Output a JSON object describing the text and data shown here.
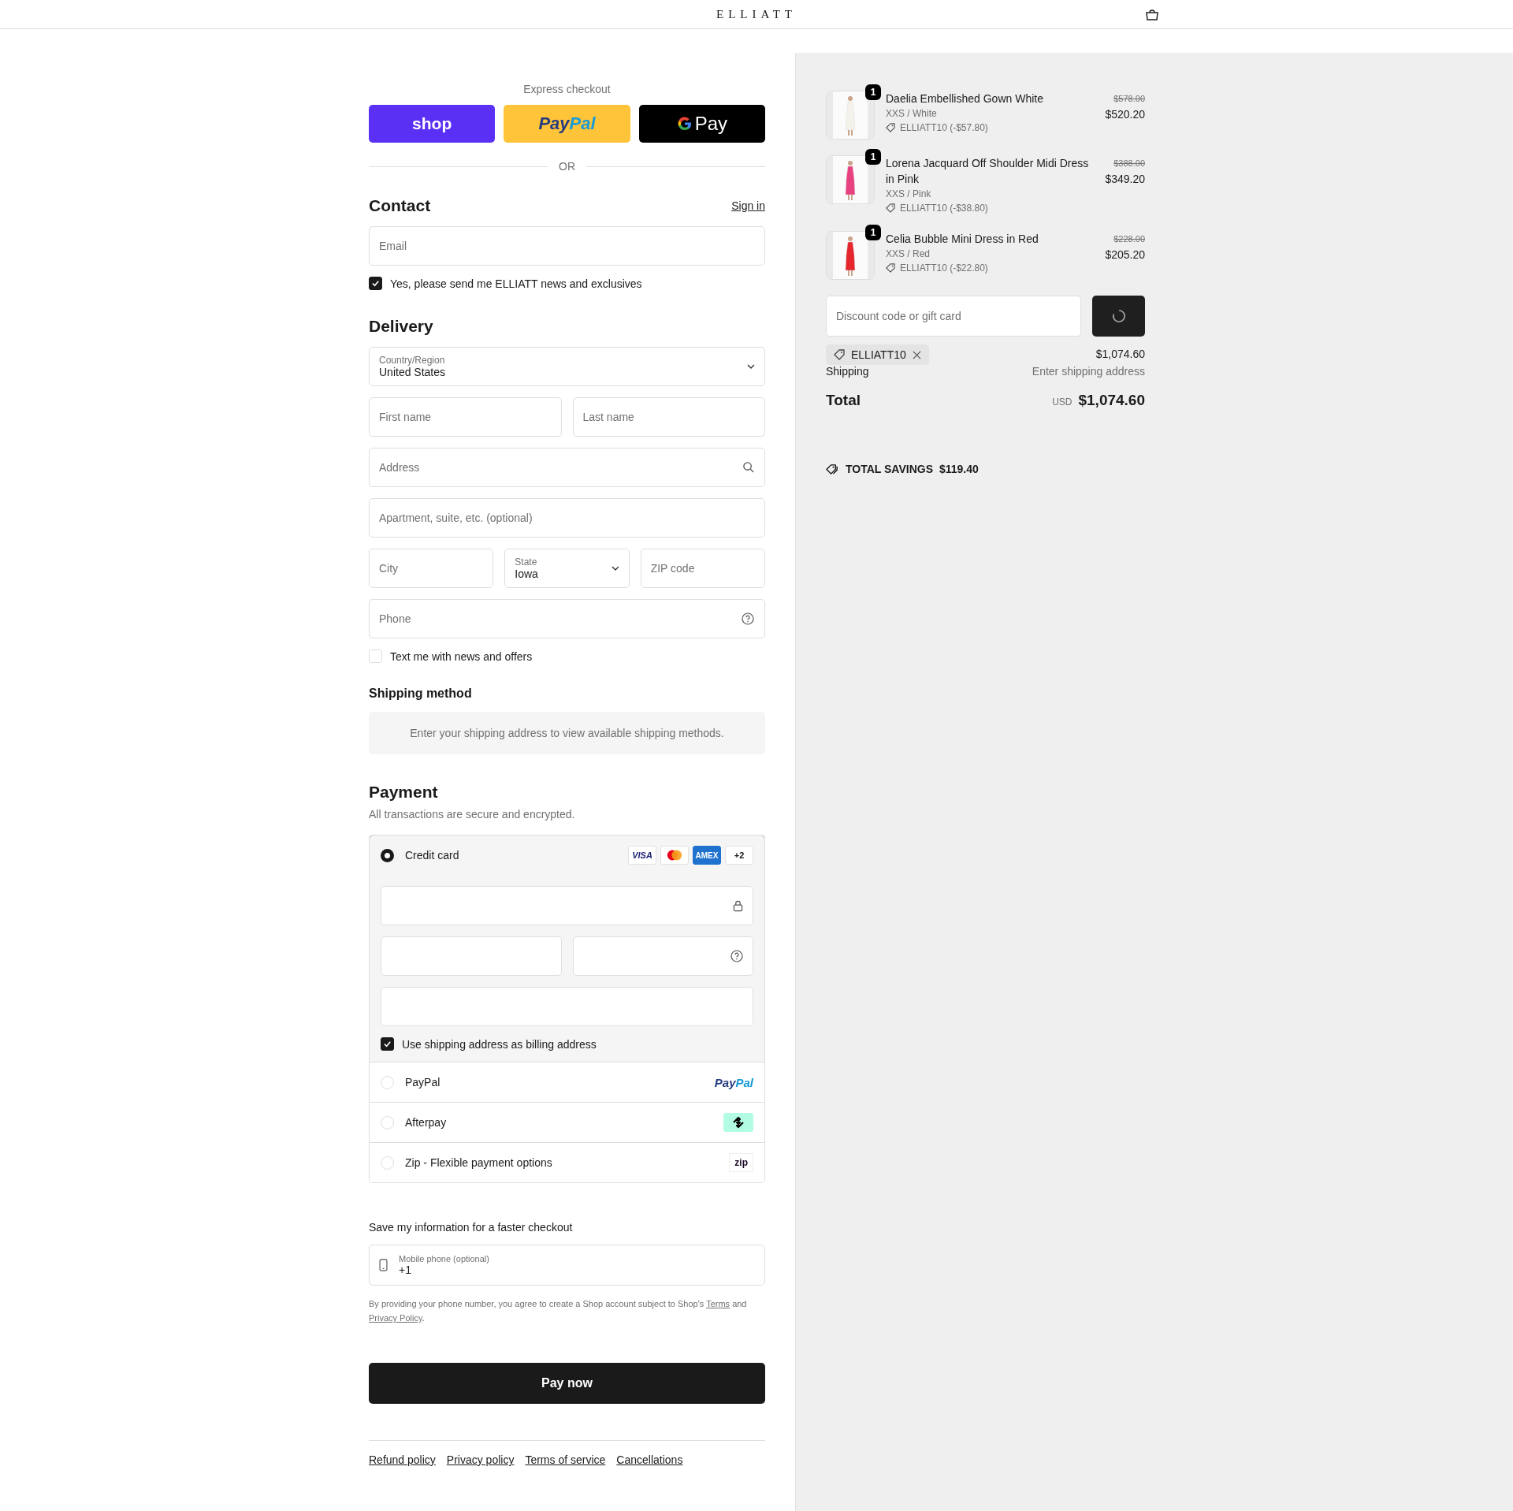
{
  "header": {
    "logo": "ELLIATT"
  },
  "express": {
    "title": "Express checkout",
    "buttons": [
      {
        "kind": "shop",
        "parts": [
          "shop"
        ]
      },
      {
        "kind": "paypal",
        "parts": [
          "Pay",
          "Pal"
        ]
      },
      {
        "kind": "gpay",
        "parts": [
          "Pay"
        ]
      }
    ],
    "divider": "OR"
  },
  "contact": {
    "heading": "Contact",
    "sign_in": "Sign in",
    "email_placeholder": "Email",
    "newsletter": {
      "label": "Yes, please send me ELLIATT news and exclusives",
      "checked": true
    }
  },
  "delivery": {
    "heading": "Delivery",
    "country": {
      "label": "Country/Region",
      "value": "United States"
    },
    "first_name_placeholder": "First name",
    "last_name_placeholder": "Last name",
    "address_placeholder": "Address",
    "apartment_placeholder": "Apartment, suite, etc. (optional)",
    "city_placeholder": "City",
    "state": {
      "label": "State",
      "value": "Iowa"
    },
    "zip_placeholder": "ZIP code",
    "phone_placeholder": "Phone",
    "sms": {
      "label": "Text me with news and offers",
      "checked": false
    }
  },
  "shipping_method": {
    "heading": "Shipping method",
    "message": "Enter your shipping address to view available shipping methods."
  },
  "payment": {
    "heading": "Payment",
    "subtitle": "All transactions are secure and encrypted.",
    "methods": [
      {
        "kind": "card",
        "label": "Credit card",
        "selected": true,
        "badges": [
          {
            "kind": "visa",
            "text": "VISA"
          },
          {
            "kind": "mastercard"
          },
          {
            "kind": "amex",
            "text": "AMEX"
          },
          {
            "kind": "more",
            "text": "+2"
          }
        ],
        "billing": {
          "label": "Use shipping address as billing address",
          "checked": true
        }
      },
      {
        "kind": "paypal",
        "label": "PayPal",
        "selected": false,
        "logo": [
          "Pay",
          "Pal"
        ]
      },
      {
        "kind": "afterpay",
        "label": "Afterpay",
        "selected": false
      },
      {
        "kind": "zip",
        "label": "Zip - Flexible payment options",
        "selected": false,
        "logo": [
          "zip"
        ]
      }
    ]
  },
  "save": {
    "title": "Save my information for a faster checkout",
    "mobile": {
      "label": "Mobile phone (optional)",
      "value": "+1"
    },
    "legal": {
      "before": "By providing your phone number, you agree to create a Shop account subject to Shop's ",
      "link1": "Terms",
      "middle": " and ",
      "link2": "Privacy Policy",
      "after": "."
    }
  },
  "pay_button": "Pay now",
  "footer_links": [
    "Refund policy",
    "Privacy policy",
    "Terms of service",
    "Cancellations"
  ],
  "summary": {
    "items": [
      {
        "name": "Daelia Embellished Gown White",
        "variant": "XXS / White",
        "discount": "ELLIATT10 (-$57.80)",
        "original_price": "$578.00",
        "price": "$520.20",
        "quantity": "1"
      },
      {
        "name": "Lorena Jacquard Off Shoulder Midi Dress in Pink",
        "variant": "XXS / Pink",
        "discount": "ELLIATT10 (-$38.80)",
        "original_price": "$388.00",
        "price": "$349.20",
        "quantity": "1"
      },
      {
        "name": "Celia Bubble Mini Dress in Red",
        "variant": "XXS / Red",
        "discount": "ELLIATT10 (-$22.80)",
        "original_price": "$228.00",
        "price": "$205.20",
        "quantity": "1"
      }
    ],
    "discount_placeholder": "Discount code or gift card",
    "applied_code": "ELLIATT10",
    "subtotal_value": "$1,074.60",
    "shipping_label": "Shipping",
    "shipping_value": "Enter shipping address",
    "total_label": "Total",
    "currency": "USD",
    "total": "$1,074.60",
    "savings_label": "TOTAL SAVINGS",
    "savings": "$119.40"
  }
}
